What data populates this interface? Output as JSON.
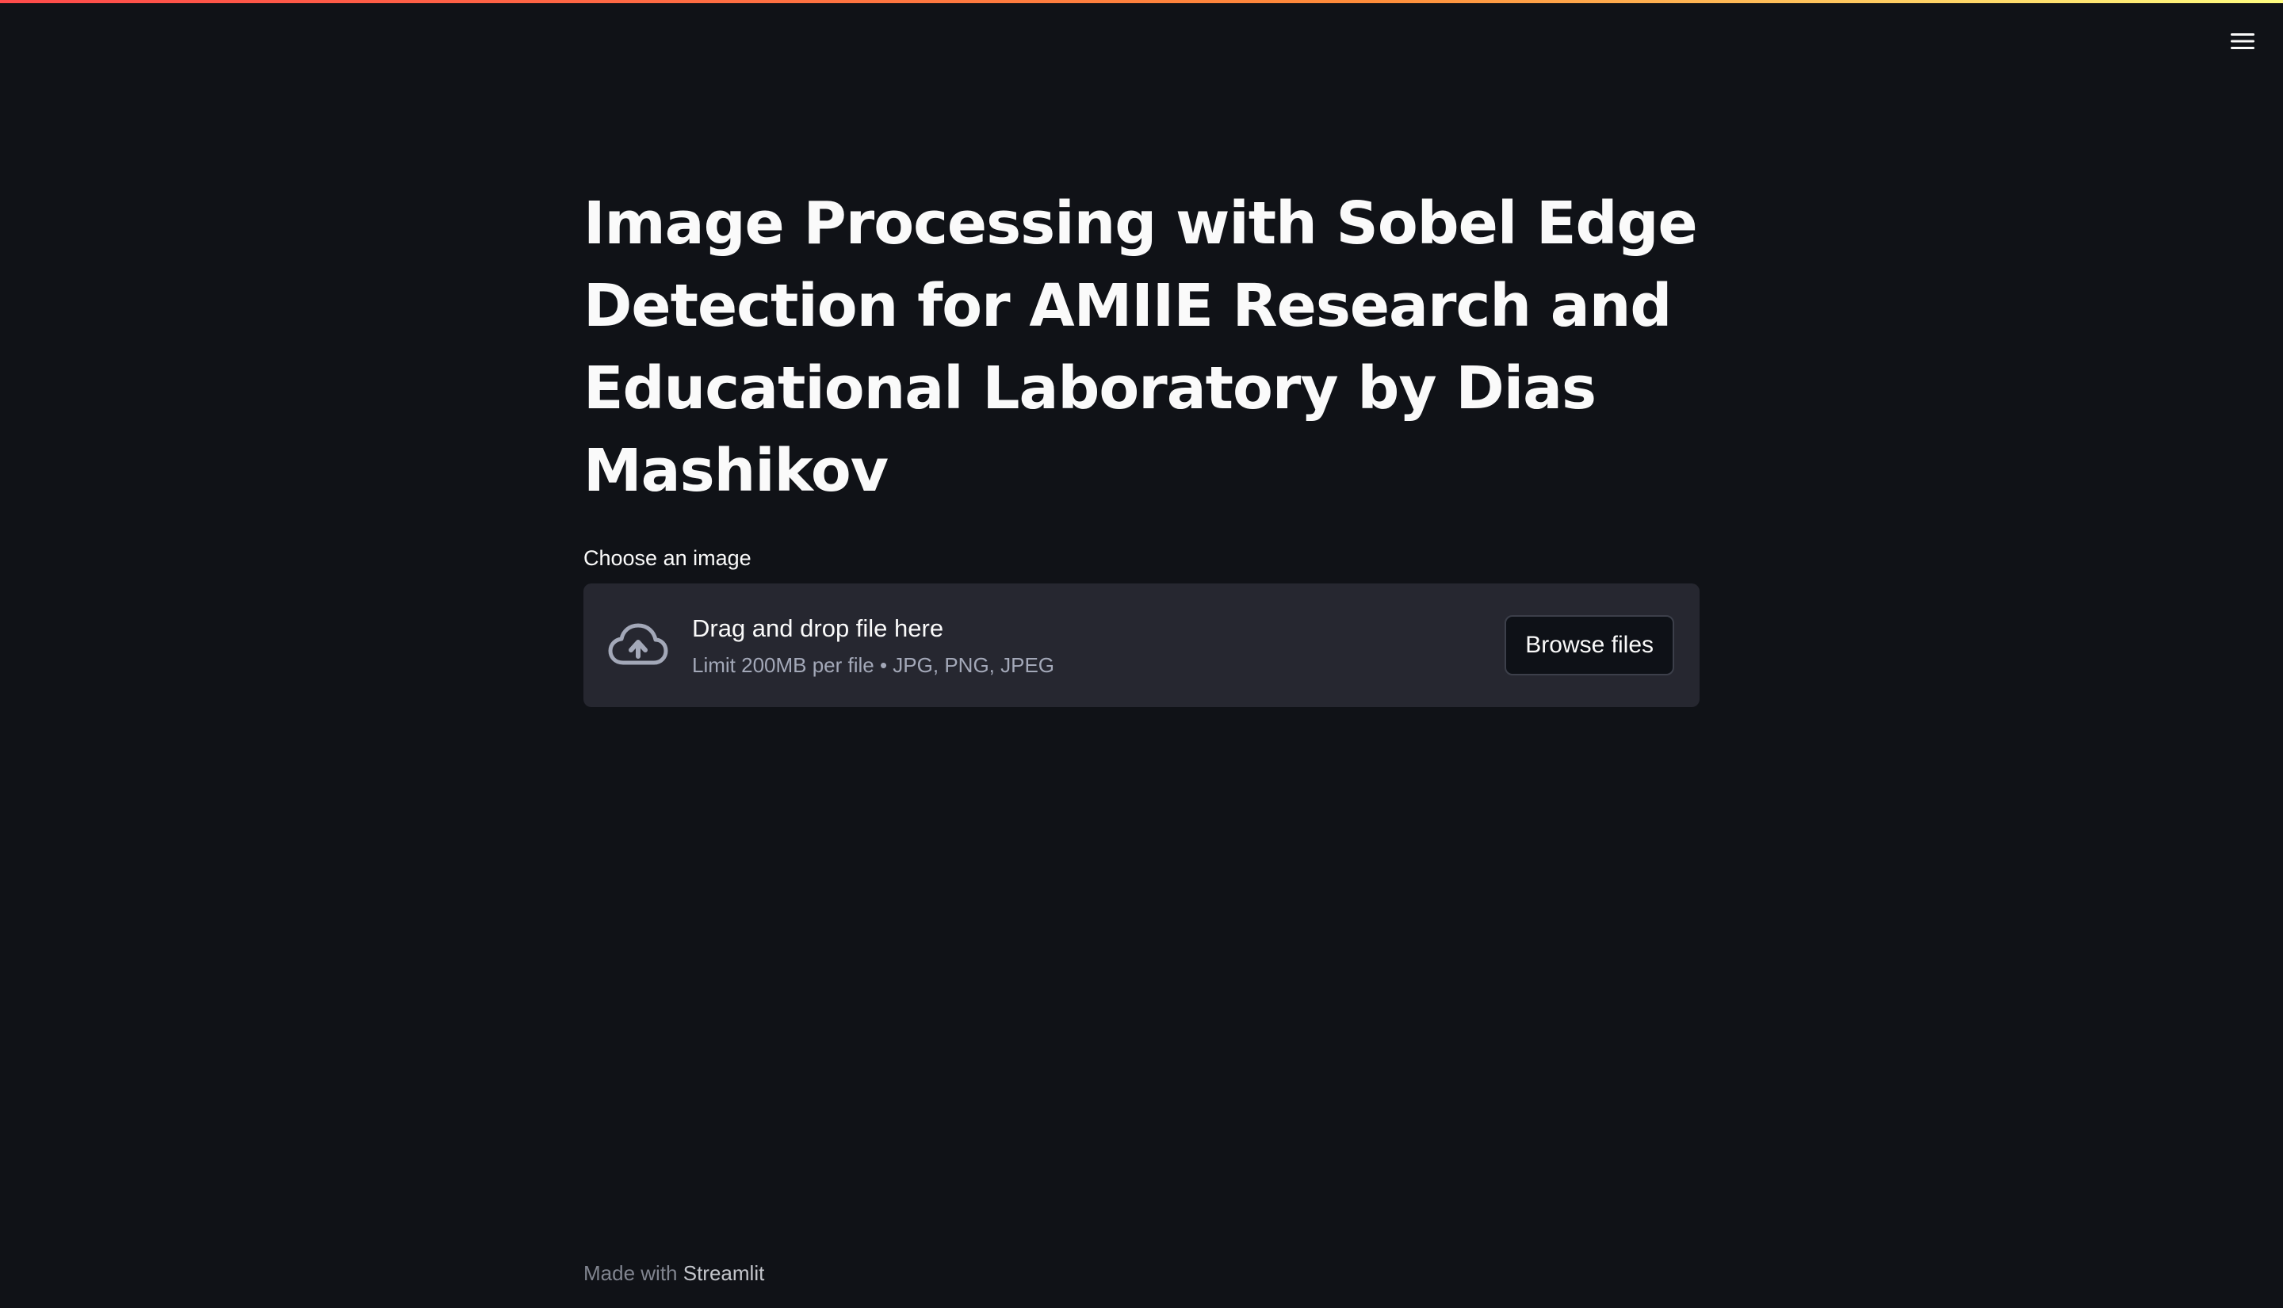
{
  "header": {
    "menu_icon": "hamburger-menu-icon"
  },
  "main": {
    "title": "Image Processing with Sobel Edge Detection for AMIIE Research and Educational Laboratory by Dias Mashikov",
    "uploader": {
      "label": "Choose an image",
      "drop_text": "Drag and drop file here",
      "limit_text": "Limit 200MB per file • JPG, PNG, JPEG",
      "browse_label": "Browse files",
      "icon": "cloud-upload-icon"
    }
  },
  "footer": {
    "prefix": "Made with",
    "brand": "Streamlit"
  },
  "colors": {
    "background": "#101217",
    "dropzone": "#262730",
    "text": "#fafafa",
    "accent_gradient_start": "#ff4b4b",
    "accent_gradient_end": "#fffd80"
  }
}
